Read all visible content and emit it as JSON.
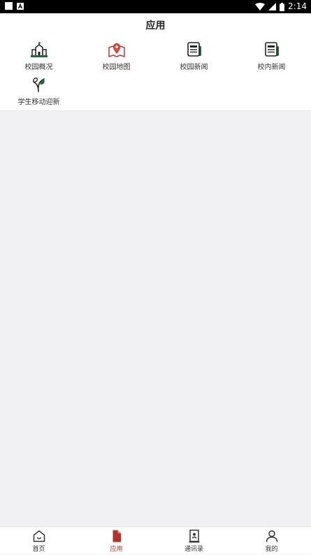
{
  "status_bar": {
    "time": "2:14",
    "icons": [
      "square-icon",
      "notification-a-icon",
      "wifi-icon",
      "signal-icon",
      "battery-icon"
    ]
  },
  "header": {
    "title": "应用"
  },
  "apps": [
    {
      "label": "校园概况",
      "icon": "campus-building-icon"
    },
    {
      "label": "校园地图",
      "icon": "map-pin-icon"
    },
    {
      "label": "校园新闻",
      "icon": "newspaper-icon"
    },
    {
      "label": "校内新闻",
      "icon": "newspaper-icon"
    },
    {
      "label": "学生移动迎新",
      "icon": "sprout-icon"
    }
  ],
  "tabs": [
    {
      "label": "首页",
      "icon": "home-icon",
      "active": false
    },
    {
      "label": "应用",
      "icon": "document-icon",
      "active": true
    },
    {
      "label": "通讯录",
      "icon": "contacts-icon",
      "active": false
    },
    {
      "label": "我的",
      "icon": "person-icon",
      "active": false
    }
  ],
  "colors": {
    "accent": "#b3322a",
    "green": "#1e6b3a",
    "background": "#f1f1f3"
  }
}
